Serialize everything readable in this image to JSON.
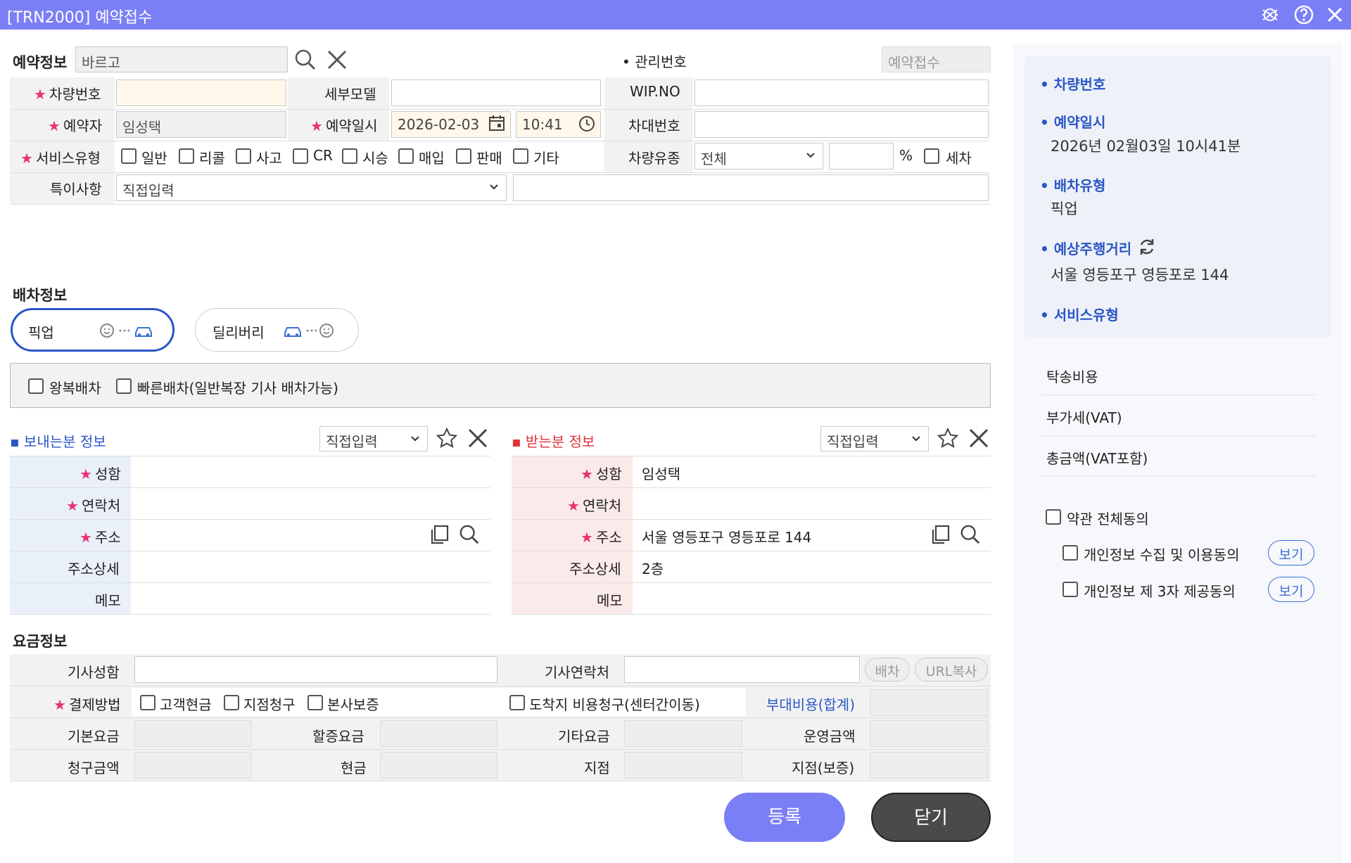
{
  "window": {
    "title": "[TRN2000] 예약접수"
  },
  "booking": {
    "section_label": "예약정보",
    "search_value": "바르고",
    "mgmt_label": "• 관리번호",
    "mgmt_value": "예약접수",
    "car_no_label": "차량번호",
    "detail_model_label": "세부모델",
    "wip_label": "WIP.NO",
    "reserver_label": "예약자",
    "reserver_value": "임성택",
    "datetime_label": "예약일시",
    "date_value": "2026-02-03",
    "time_value": "10:41",
    "chassis_label": "차대번호",
    "service_type_label": "서비스유형",
    "service_types": [
      "일반",
      "리콜",
      "사고",
      "CR",
      "시승",
      "매입",
      "판매",
      "기타"
    ],
    "oil_label": "차량유종",
    "oil_value": "전체",
    "percent": "%",
    "wash_label": "세차",
    "note_label": "특이사항",
    "note_select": "직접입력"
  },
  "dispatch": {
    "section_label": "배차정보",
    "pickup": "픽업",
    "delivery": "딜리버리",
    "round_trip": "왕복배차",
    "fast": "빠른배차(일반복장 기사 배차가능)"
  },
  "sender": {
    "title": "보내는분 정보",
    "select": "직접입력",
    "name_label": "성함",
    "phone_label": "연락처",
    "addr_label": "주소",
    "addr_detail_label": "주소상세",
    "memo_label": "메모"
  },
  "receiver": {
    "title": "받는분 정보",
    "select": "직접입력",
    "name_label": "성함",
    "name_value": "임성택",
    "phone_label": "연락처",
    "addr_label": "주소",
    "addr_value": "서울 영등포구 영등포로 144",
    "addr_detail_label": "주소상세",
    "addr_detail_value": "2층",
    "memo_label": "메모"
  },
  "fee": {
    "section_label": "요금정보",
    "driver_name": "기사성함",
    "driver_phone": "기사연락처",
    "dispatch_btn": "배차",
    "url_btn": "URL복사",
    "pay_label": "결제방법",
    "pay_options": [
      "고객현금",
      "지점청구",
      "본사보증"
    ],
    "dest_charge": "도착지 비용청구(센터간이동)",
    "extra_cost": "부대비용(합계)",
    "base": "기본요금",
    "surcharge": "할증요금",
    "other": "기타요금",
    "operating": "운영금액",
    "claim": "청구금액",
    "cash": "현금",
    "branch": "지점",
    "branch_guarantee": "지점(보증)"
  },
  "actions": {
    "register": "등록",
    "close": "닫기"
  },
  "side": {
    "car_no": "• 차량번호",
    "res_datetime": "• 예약일시",
    "res_datetime_value": "2026년 02월03일 10시41분",
    "dispatch_type": "• 배차유형",
    "dispatch_type_value": "픽업",
    "distance": "• 예상주행거리",
    "distance_addr": "서울 영등포구 영등포로 144",
    "service_type": "• 서비스유형",
    "transport_cost": "탁송비용",
    "vat": "부가세(VAT)",
    "total": "총금액(VAT포함)",
    "agree_all": "약관 전체동의",
    "agree_privacy": "개인정보 수집 및 이용동의",
    "agree_third": "개인정보 제 3자 제공동의",
    "view": "보기"
  },
  "colors": {
    "titlebar": "#7b7ff5",
    "accent_blue": "#2a56c6",
    "required": "#e8336d",
    "register_btn": "#7b7ff5",
    "close_btn": "#4a4a4a"
  }
}
